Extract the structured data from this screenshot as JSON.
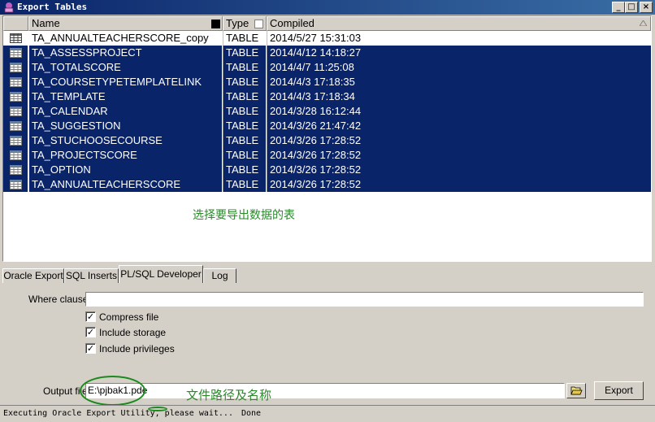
{
  "window": {
    "title": "Export Tables"
  },
  "table": {
    "headers": {
      "name": "Name",
      "type": "Type",
      "compiled": "Compiled"
    },
    "rows": [
      {
        "name": "TA_ANNUALTEACHERSCORE_copy",
        "type": "TABLE",
        "compiled": "2014/5/27 15:31:03",
        "selected": false
      },
      {
        "name": "TA_ASSESSPROJECT",
        "type": "TABLE",
        "compiled": "2014/4/12 14:18:27",
        "selected": true
      },
      {
        "name": "TA_TOTALSCORE",
        "type": "TABLE",
        "compiled": "2014/4/7 11:25:08",
        "selected": true
      },
      {
        "name": "TA_COURSETYPETEMPLATELINK",
        "type": "TABLE",
        "compiled": "2014/4/3 17:18:35",
        "selected": true
      },
      {
        "name": "TA_TEMPLATE",
        "type": "TABLE",
        "compiled": "2014/4/3 17:18:34",
        "selected": true
      },
      {
        "name": "TA_CALENDAR",
        "type": "TABLE",
        "compiled": "2014/3/28 16:12:44",
        "selected": true
      },
      {
        "name": "TA_SUGGESTION",
        "type": "TABLE",
        "compiled": "2014/3/26 21:47:42",
        "selected": true
      },
      {
        "name": "TA_STUCHOOSECOURSE",
        "type": "TABLE",
        "compiled": "2014/3/26 17:28:52",
        "selected": true
      },
      {
        "name": "TA_PROJECTSCORE",
        "type": "TABLE",
        "compiled": "2014/3/26 17:28:52",
        "selected": true
      },
      {
        "name": "TA_OPTION",
        "type": "TABLE",
        "compiled": "2014/3/26 17:28:52",
        "selected": true
      },
      {
        "name": "TA_ANNUALTEACHERSCORE",
        "type": "TABLE",
        "compiled": "2014/3/26 17:28:52",
        "selected": true
      }
    ],
    "annotation": "选择要导出数据的表"
  },
  "tabs": [
    {
      "label": "Oracle Export",
      "active": false
    },
    {
      "label": "SQL Inserts",
      "active": false
    },
    {
      "label": "PL/SQL Developer",
      "active": true
    },
    {
      "label": "Log",
      "active": false
    }
  ],
  "options": {
    "where_label": "Where clause",
    "where_value": "",
    "compress_label": "Compress file",
    "compress_checked": true,
    "storage_label": "Include storage",
    "storage_checked": true,
    "privileges_label": "Include privileges",
    "privileges_checked": true,
    "output_label": "Output file",
    "output_value": "E:\\pjbak1.pde",
    "output_annotation": "文件路径及名称",
    "export_label": "Export"
  },
  "status": {
    "message": "Executing Oracle Export Utility, please wait...",
    "state": "Done"
  },
  "colors": {
    "selection": "#0a246a",
    "annotation": "#2a8a2a"
  }
}
